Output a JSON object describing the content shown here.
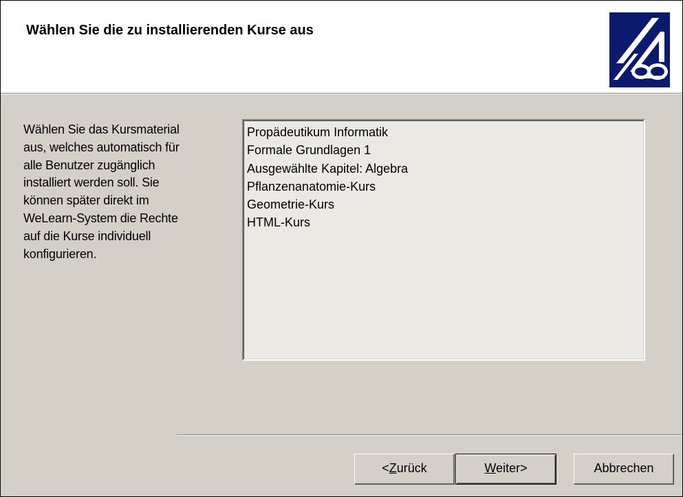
{
  "header": {
    "title": "Wählen Sie die zu installierenden Kurse aus",
    "logo_icon": "welearn-logo-icon"
  },
  "description": {
    "lines": [
      "Wählen Sie das Kursmaterial",
      "aus, welches automatisch für",
      "alle Benutzer zugänglich",
      "installiert werden soll. Sie",
      "können später direkt im",
      "WeLearn-System die Rechte",
      "auf die Kurse individuell",
      "konfigurieren."
    ]
  },
  "course_list": {
    "items": [
      "Propädeutikum Informatik",
      "Formale Grundlagen 1",
      "Ausgewählte Kapitel: Algebra",
      "Pflanzenanatomie-Kurs",
      "Geometrie-Kurs",
      "HTML-Kurs"
    ]
  },
  "buttons": {
    "back": {
      "prefix": "<",
      "mnemonic": "Z",
      "rest": "urück"
    },
    "next": {
      "mnemonic": "W",
      "rest": "eiter>"
    },
    "cancel": {
      "label": "Abbrechen"
    }
  },
  "colors": {
    "dialog_background": "#d4d0c8",
    "header_background": "#ffffff",
    "listbox_background": "#ebe9e4",
    "logo_background": "#0a1a6e"
  }
}
